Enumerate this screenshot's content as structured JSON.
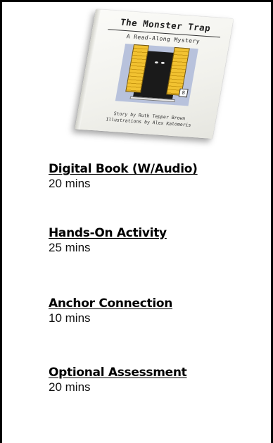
{
  "book": {
    "title": "The Monster Trap",
    "subtitle": "A Read-Along Mystery",
    "badge": "8",
    "story_credit": "Story by Ruth Tepper Brown",
    "illustration_credit": "Illustrations by Alex Kalomeris"
  },
  "activities": [
    {
      "title": "Digital Book (W/Audio)",
      "duration": "20 mins"
    },
    {
      "title": "Hands-On Activity",
      "duration": "25 mins"
    },
    {
      "title": "Anchor Connection",
      "duration": "10 mins"
    },
    {
      "title": "Optional Assessment",
      "duration": "20 mins"
    }
  ],
  "colors": {
    "border": "#000000",
    "shutter": "#f2c231",
    "sky": "#b8c2dc"
  }
}
